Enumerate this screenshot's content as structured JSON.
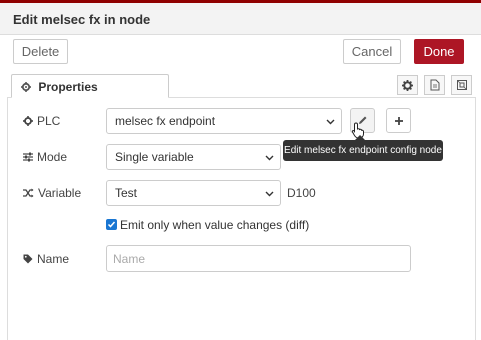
{
  "dialog": {
    "title": "Edit melsec fx in node"
  },
  "buttons": {
    "delete": "Delete",
    "cancel": "Cancel",
    "done": "Done"
  },
  "tabs": {
    "properties": "Properties"
  },
  "fields": {
    "plc": {
      "label": "PLC",
      "value": "melsec fx endpoint"
    },
    "mode": {
      "label": "Mode",
      "value": "Single variable"
    },
    "variable": {
      "label": "Variable",
      "value": "Test",
      "suffix": "D100"
    },
    "diff": {
      "label": "Emit only when value changes (diff)",
      "checked": true
    },
    "name": {
      "label": "Name",
      "placeholder": "Name",
      "value": ""
    }
  },
  "tooltip": {
    "text": "Edit melsec fx endpoint config node"
  },
  "icons": {
    "properties": "gear-icon",
    "plc": "gear-icon",
    "mode": "sliders-icon",
    "variable": "shuffle-icon",
    "name": "tag-icon",
    "edit": "pencil-icon",
    "add": "plus-icon",
    "tab_settings": "gear-icon",
    "tab_description": "file-icon",
    "tab_appearance": "layout-icon",
    "cursor": "hand-pointer-icon"
  },
  "colors": {
    "accent": "#ad1625",
    "checkbox": "#1976d2",
    "tooltip_bg": "#333333"
  }
}
